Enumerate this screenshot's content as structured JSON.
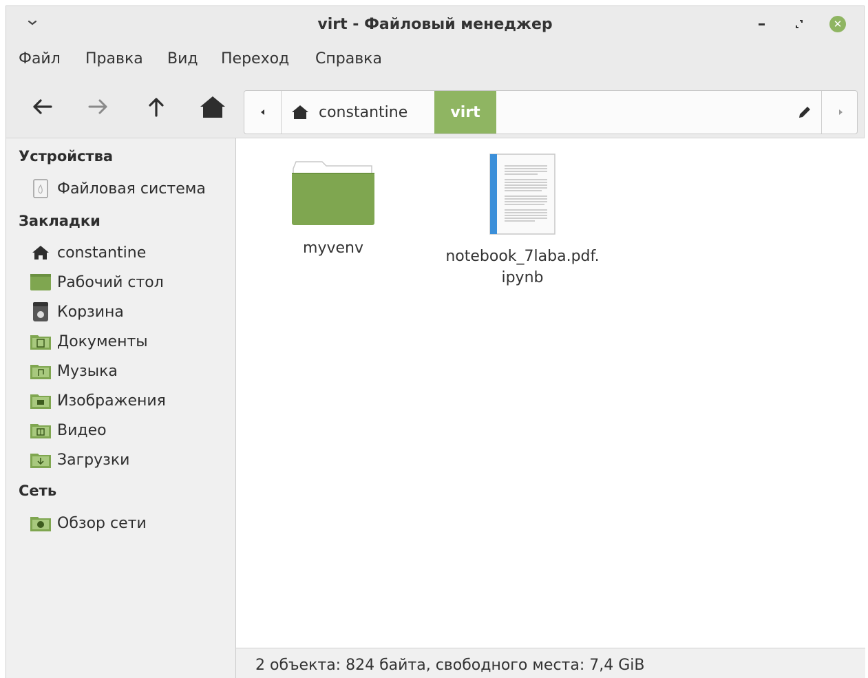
{
  "window": {
    "title": "virt - Файловый менеджер"
  },
  "menubar": {
    "items": [
      "Файл",
      "Правка",
      "Вид",
      "Переход",
      "Справка"
    ]
  },
  "toolbar": {
    "back_icon": "arrow-left-icon",
    "forward_icon": "arrow-right-icon",
    "up_icon": "arrow-up-icon",
    "home_icon": "home-icon"
  },
  "pathbar": {
    "home_crumb": "constantine",
    "current_crumb": "virt",
    "accent_color": "#8fb562"
  },
  "sidebar": {
    "sections": [
      {
        "title": "Устройства",
        "items": [
          {
            "label": "Файловая система",
            "icon": "drive-icon"
          }
        ]
      },
      {
        "title": "Закладки",
        "items": [
          {
            "label": "constantine",
            "icon": "home-icon"
          },
          {
            "label": "Рабочий стол",
            "icon": "desktop-icon"
          },
          {
            "label": "Корзина",
            "icon": "trash-icon"
          },
          {
            "label": "Документы",
            "icon": "documents-folder-icon"
          },
          {
            "label": "Музыка",
            "icon": "music-folder-icon"
          },
          {
            "label": "Изображения",
            "icon": "pictures-folder-icon"
          },
          {
            "label": "Видео",
            "icon": "video-folder-icon"
          },
          {
            "label": "Загрузки",
            "icon": "downloads-folder-icon"
          }
        ]
      },
      {
        "title": "Сеть",
        "items": [
          {
            "label": "Обзор сети",
            "icon": "network-folder-icon"
          }
        ]
      }
    ]
  },
  "files": [
    {
      "name": "myvenv",
      "icon": "folder-icon"
    },
    {
      "name_line1": "notebook_7laba.pdf.",
      "name_line2": "ipynb",
      "icon": "document-icon"
    }
  ],
  "statusbar": {
    "text": "2 объекта: 824 байта, свободного места: 7,4 GiB"
  }
}
